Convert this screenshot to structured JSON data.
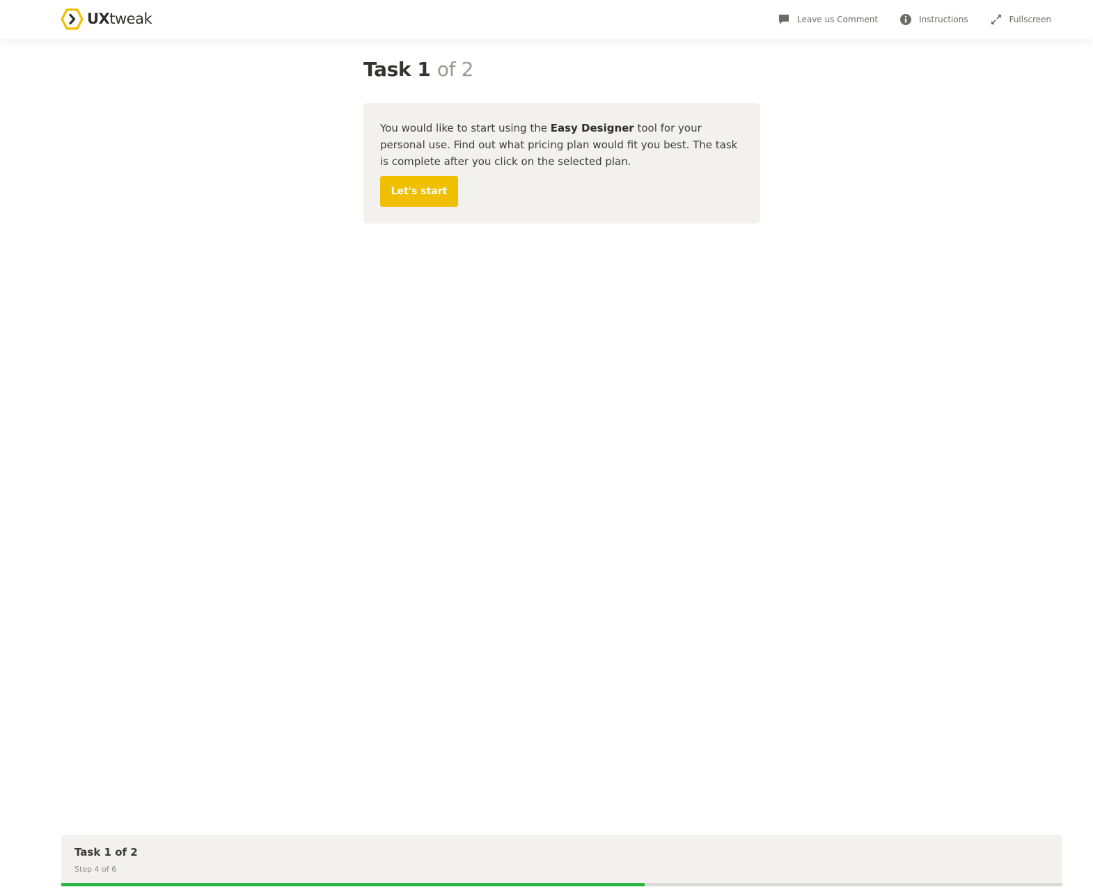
{
  "header": {
    "logo_text_bold": "UX",
    "logo_text_light": "tweak",
    "actions": [
      {
        "label": "Leave us Comment",
        "icon": "comment-icon"
      },
      {
        "label": "Instructions",
        "icon": "info-icon"
      },
      {
        "label": "Fullscreen",
        "icon": "fullscreen-icon"
      }
    ]
  },
  "main": {
    "title_strong": "Task 1",
    "title_light": "of 2",
    "text_before": "You would like to start using the ",
    "text_bold": "Easy Designer",
    "text_after": " tool for your personal use. Find out what pricing plan would fit you best. The task is complete after you click on the selected plan.",
    "start_label": "Let's start"
  },
  "footer": {
    "title": "Task 1 of 2",
    "step": "Step 4 of 6",
    "progress": 0.583
  },
  "colors": {
    "accent": "#f0bf00",
    "progress": "#2db742",
    "card_bg": "#f2f1ed"
  }
}
